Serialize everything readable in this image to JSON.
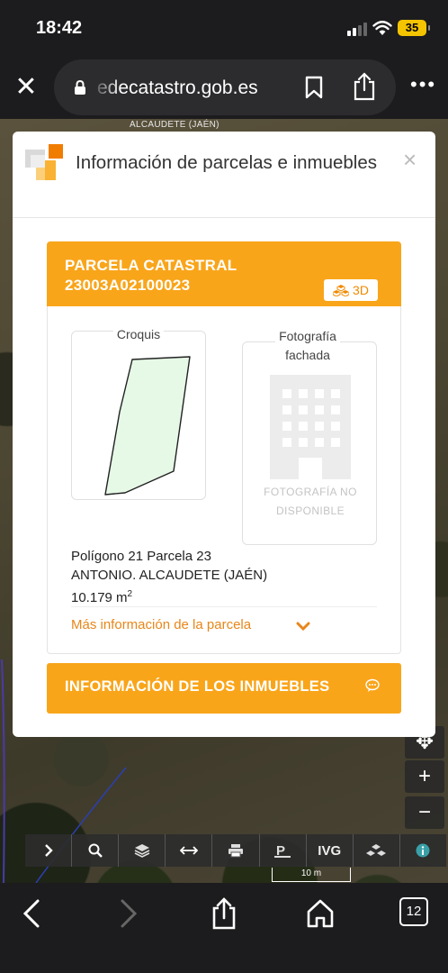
{
  "status": {
    "time": "18:42",
    "battery": "35"
  },
  "browser": {
    "url": "edecatastro.gob.es"
  },
  "map": {
    "label": "ALCAUDETE (JAÉN)",
    "scale": "10 m",
    "toolbar": [
      ">",
      "search-icon",
      "layers-icon",
      "measure-icon",
      "print-icon",
      "parking-icon",
      "IVG",
      "3d-icon",
      "info-icon"
    ],
    "tool_ivg": "IVG"
  },
  "dialog": {
    "title": "Información de parcelas e inmuebles",
    "close": "×",
    "card": {
      "title_line1": "PARCELA CATASTRAL",
      "title_line2": "23003A02100023",
      "btn_3d": "3D",
      "croquis_label": "Croquis",
      "foto_label_1": "Fotografía",
      "foto_label_2": "fachada",
      "foto_caption_1": "FOTOGRAFÍA NO",
      "foto_caption_2": "DISPONIBLE",
      "line1": "Polígono 21 Parcela 23",
      "line2": "ANTONIO. ALCAUDETE (JAÉN)",
      "area_value": "10.179 m",
      "area_unit_exp": "2",
      "mas_info": "Más información de la parcela"
    },
    "inmuebles_btn": "INFORMACIÓN DE LOS INMUEBLES"
  },
  "bottom": {
    "tabs_count": "12"
  },
  "colors": {
    "accent": "#f9a51a",
    "link": "#e8861a",
    "parcel_fill": "#e6f8e6"
  }
}
